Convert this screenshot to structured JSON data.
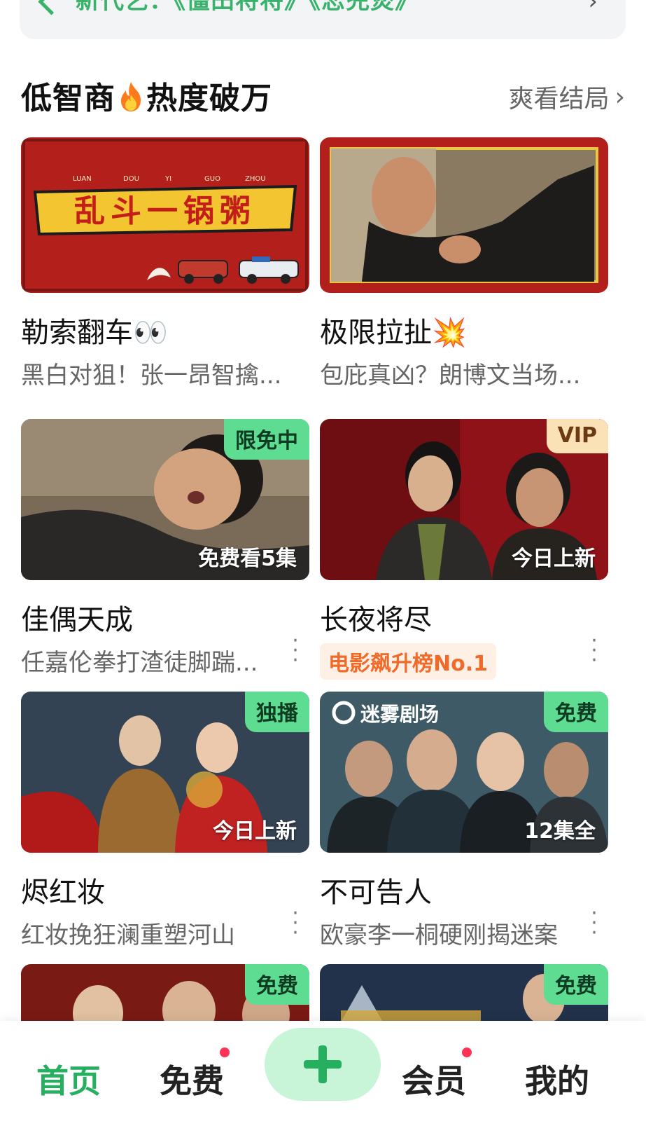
{
  "top_banner": {
    "text": "新代乞：《僵田将将》《恋兜煲》"
  },
  "section": {
    "title_left": "低智商",
    "title_right": "热度破万",
    "more_label": "爽看结局",
    "more_icon": "chevron-right-icon"
  },
  "cards": [
    {
      "title": "勒索翻车👀",
      "subtitle": "黑白对狙！张一昂智擒...",
      "thumb_text": "乱斗一锅粥",
      "thumb_pinyin": [
        "LUAN",
        "DOU",
        "YI",
        "GUO",
        "ZHOU"
      ]
    },
    {
      "title": "极限拉扯💥",
      "subtitle": "包庇真凶？朗博文当场..."
    },
    {
      "title": "佳偶天成",
      "subtitle": "任嘉伦拳打渣徒脚踹...",
      "badge": "限免中",
      "overlay": "免费看5集"
    },
    {
      "title": "长夜将尽",
      "tag": "电影飙升榜No.1",
      "badge": "VIP",
      "overlay": "今日上新"
    },
    {
      "title": "烬红妆",
      "subtitle": "红妆挽狂澜重塑河山",
      "badge": "独播",
      "overlay": "今日上新"
    },
    {
      "title": "不可告人",
      "subtitle": "欧豪李一桐硬刚揭迷案",
      "badge": "免费",
      "overlay": "12集全",
      "brand": "迷雾剧场"
    },
    {
      "badge": "免费"
    },
    {
      "badge": "免费"
    }
  ],
  "bottom_nav": {
    "items": [
      {
        "label": "首页",
        "active": true
      },
      {
        "label": "免费",
        "dot": true
      },
      {
        "label": "+",
        "icon": "plus-icon"
      },
      {
        "label": "会员",
        "dot": true
      },
      {
        "label": "我的"
      }
    ]
  },
  "colors": {
    "accent": "#25b060",
    "badge_green": "#5ddc92",
    "vip": "#fbe2b6",
    "tag_orange": "#f06a2a"
  }
}
